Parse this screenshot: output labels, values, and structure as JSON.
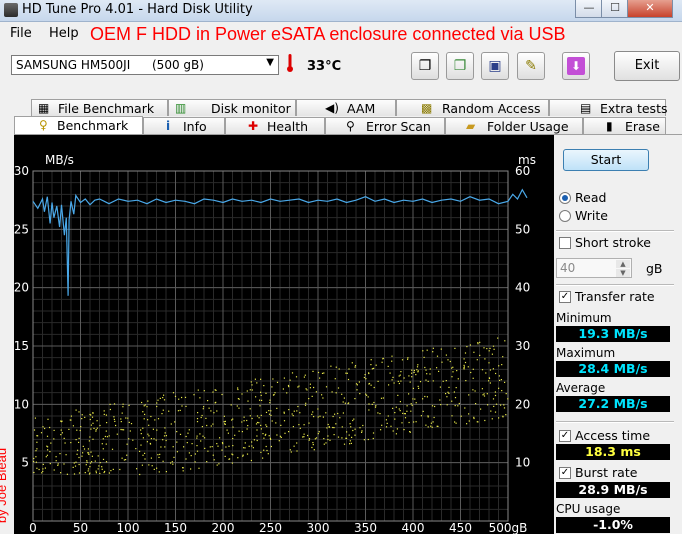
{
  "window": {
    "title": "HD Tune Pro 4.01 - Hard Disk Utility",
    "min": "—",
    "max": "☐",
    "close": "✕"
  },
  "menu": {
    "file": "File",
    "help": "Help"
  },
  "overlay": {
    "caption": "OEM F HDD in Power eSATA enclosure connected via USB",
    "watermark": "by Joe Bleau"
  },
  "toolbar": {
    "drive_name": "SAMSUNG HM500JI",
    "drive_capacity": "(500 gB)",
    "temperature": "33°C",
    "exit_label": "Exit"
  },
  "tabs_top": [
    {
      "label": "File Benchmark",
      "icon": "file-benchmark-icon"
    },
    {
      "label": "Disk monitor",
      "icon": "disk-monitor-icon"
    },
    {
      "label": "AAM",
      "icon": "speaker-icon"
    },
    {
      "label": "Random Access",
      "icon": "random-access-icon"
    },
    {
      "label": "Extra tests",
      "icon": "extra-tests-icon"
    }
  ],
  "tabs_bottom": [
    {
      "label": "Benchmark",
      "icon": "benchmark-icon"
    },
    {
      "label": "Info",
      "icon": "info-icon"
    },
    {
      "label": "Health",
      "icon": "health-cross-icon"
    },
    {
      "label": "Error Scan",
      "icon": "magnifier-icon"
    },
    {
      "label": "Folder Usage",
      "icon": "folder-icon"
    },
    {
      "label": "Erase",
      "icon": "trash-icon"
    }
  ],
  "side": {
    "start": "Start",
    "read": "Read",
    "write": "Write",
    "short_stroke": "Short stroke",
    "short_stroke_value": "40",
    "gb": "gB",
    "transfer_rate": "Transfer rate",
    "minimum_label": "Minimum",
    "minimum": "19.3 MB/s",
    "maximum_label": "Maximum",
    "maximum": "28.4 MB/s",
    "average_label": "Average",
    "average": "27.2 MB/s",
    "access_time": "Access time",
    "access_time_value": "18.3 ms",
    "burst_rate": "Burst rate",
    "burst_rate_value": "28.9 MB/s",
    "cpu_usage": "CPU usage",
    "cpu_usage_value": "-1.0%"
  },
  "chart_data": {
    "type": "line",
    "ylabel_left": "MB/s",
    "ylabel_right": "ms",
    "xunit": "gB",
    "left_ticks": [
      5,
      10,
      15,
      20,
      25,
      30
    ],
    "right_ticks": [
      10,
      20,
      30,
      40,
      50,
      60
    ],
    "x_ticks": [
      0,
      50,
      100,
      150,
      200,
      250,
      300,
      350,
      400,
      450,
      500
    ],
    "xlim": [
      0,
      500
    ],
    "ylim_left": [
      0,
      30
    ],
    "ylim_right": [
      0,
      60
    ],
    "grid": true,
    "series": [
      {
        "color": "#4aa8e8",
        "x": [
          0,
          5,
          10,
          12,
          15,
          18,
          20,
          22,
          25,
          28,
          30,
          33,
          35,
          37,
          38,
          40,
          43,
          45,
          50,
          55,
          60,
          65,
          70,
          75,
          80,
          90,
          100,
          110,
          120,
          130,
          140,
          150,
          160,
          170,
          180,
          190,
          200,
          210,
          220,
          230,
          240,
          250,
          260,
          270,
          280,
          290,
          300,
          310,
          320,
          330,
          340,
          350,
          360,
          370,
          380,
          390,
          400,
          410,
          420,
          430,
          440,
          450,
          460,
          470,
          480,
          490,
          500,
          505,
          510,
          515,
          520
        ],
        "values": [
          27.4,
          26.8,
          27.6,
          26.5,
          27.8,
          25.5,
          27.3,
          26.0,
          27.0,
          25.2,
          27.1,
          24.5,
          26.0,
          19.3,
          25.8,
          27.4,
          26.3,
          27.9,
          27.3,
          27.6,
          27.1,
          27.5,
          27.6,
          27.4,
          27.2,
          27.6,
          27.4,
          27.5,
          27.2,
          27.6,
          27.3,
          27.5,
          27.4,
          27.2,
          27.6,
          27.5,
          27.3,
          27.6,
          27.4,
          27.5,
          27.3,
          27.6,
          27.4,
          27.5,
          27.6,
          27.3,
          27.5,
          27.4,
          27.6,
          27.3,
          27.5,
          27.8,
          27.4,
          27.6,
          27.3,
          27.5,
          27.4,
          27.6,
          27.3,
          27.5,
          27.6,
          27.4,
          27.8,
          27.5,
          27.6,
          27.2,
          27.4,
          28.0,
          27.6,
          28.4,
          27.7
        ]
      },
      {
        "type": "scatter",
        "axis": "right",
        "color": "#e8e84a",
        "x_range": [
          0,
          500
        ],
        "values_range": [
          8,
          33
        ]
      }
    ]
  }
}
